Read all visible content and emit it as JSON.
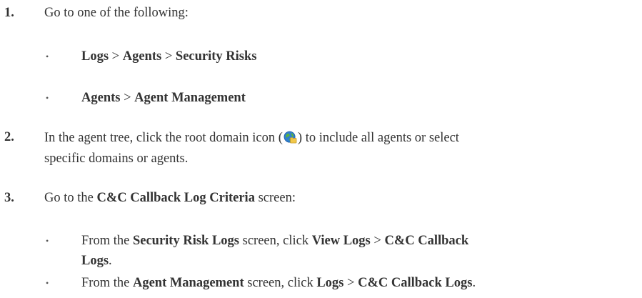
{
  "steps": [
    {
      "number": "1.",
      "text": "Go to one of the following:",
      "options": [
        {
          "bullet": "•",
          "a": "Logs",
          "sep1": " > ",
          "b": "Agents",
          "sep2": " > ",
          "c": "Security Risks"
        },
        {
          "bullet": "•",
          "a": "Agents",
          "sep1": " > ",
          "b": "Agent Management"
        }
      ]
    },
    {
      "number": "2.",
      "line1_before": "In the agent tree, click the root domain icon (",
      "line1_after": ") to include all agents or select",
      "line2": "specific domains or agents.",
      "icon": "globe-domain-icon"
    },
    {
      "number": "3.",
      "before": "Go to the ",
      "bold": "C&C Callback Log Criteria",
      "after": " screen:",
      "options": [
        {
          "bullet": "•",
          "t1": "From the ",
          "b1": "Security Risk Logs",
          "t2": " screen, click ",
          "b2": "View Logs",
          "t3": " > ",
          "b3": "C&C Callback",
          "b4": "Logs",
          "t4": "."
        },
        {
          "bullet": "•",
          "t1": "From the ",
          "b1": "Agent Management",
          "t2": " screen, click ",
          "b2": "Logs",
          "t3": " > ",
          "b3": "C&C Callback Logs",
          "t4": "."
        }
      ]
    }
  ],
  "colors": {
    "text": "#333333",
    "globe_blue": "#2f7fd0",
    "globe_green": "#5bb33b",
    "folder_yellow": "#f2c84b"
  }
}
